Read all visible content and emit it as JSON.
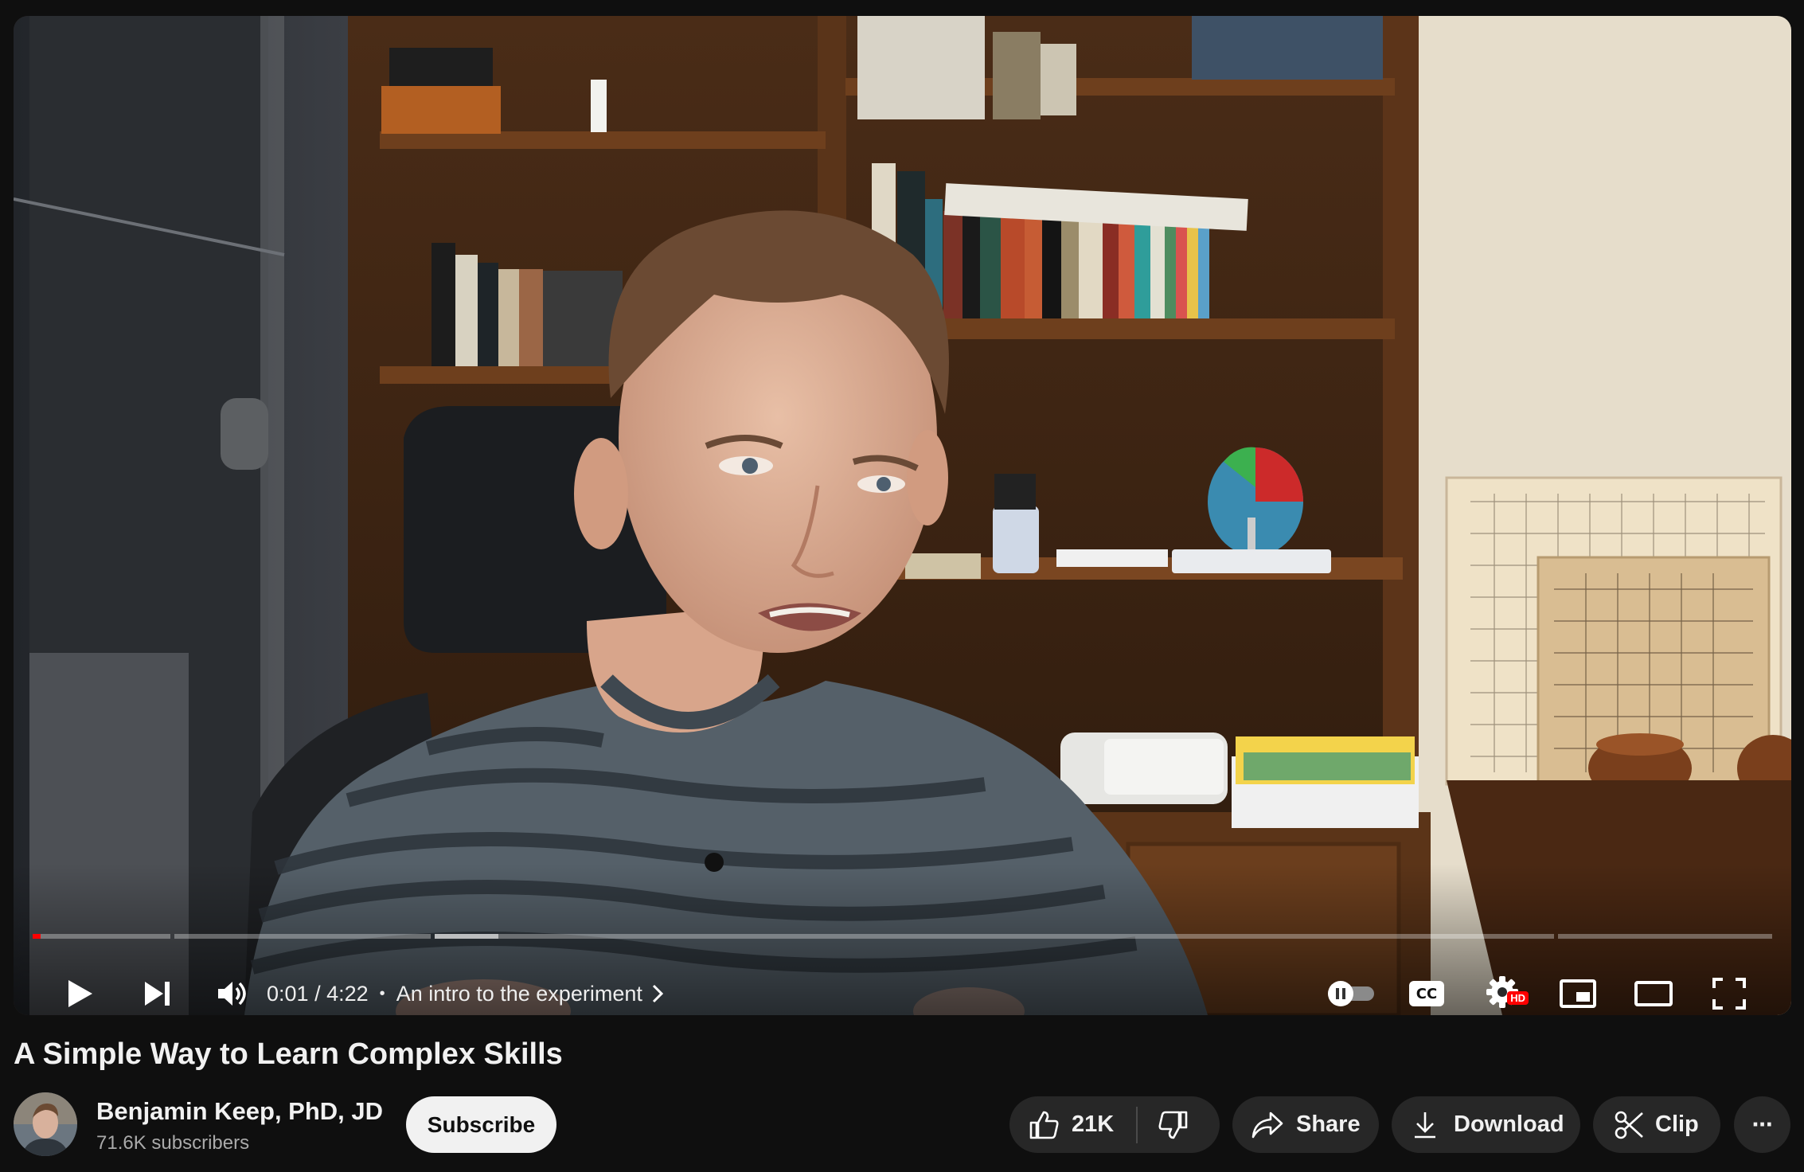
{
  "player": {
    "current_time": "0:01",
    "time_separator": "/",
    "duration": "4:22",
    "chapter_dot": "•",
    "chapter_title": "An intro to the experiment",
    "hd_badge": "HD",
    "progress_played_fraction": 0.0006,
    "controls": [
      "play-icon",
      "next-icon",
      "volume-icon",
      "autoplay-toggle",
      "captions-icon",
      "settings-icon",
      "miniplayer-icon",
      "theater-icon",
      "fullscreen-icon"
    ],
    "captions_label": "CC"
  },
  "video": {
    "title": "A Simple Way to Learn Complex Skills"
  },
  "channel": {
    "name": "Benjamin Keep, PhD, JD",
    "subscribers": "71.6K subscribers",
    "subscribe_label": "Subscribe"
  },
  "actions": {
    "like_count": "21K",
    "share_label": "Share",
    "download_label": "Download",
    "clip_label": "Clip",
    "more_label": "···"
  },
  "colors": {
    "accent": "#ff0000",
    "background": "#0f0f0f",
    "pill": "#272727"
  }
}
